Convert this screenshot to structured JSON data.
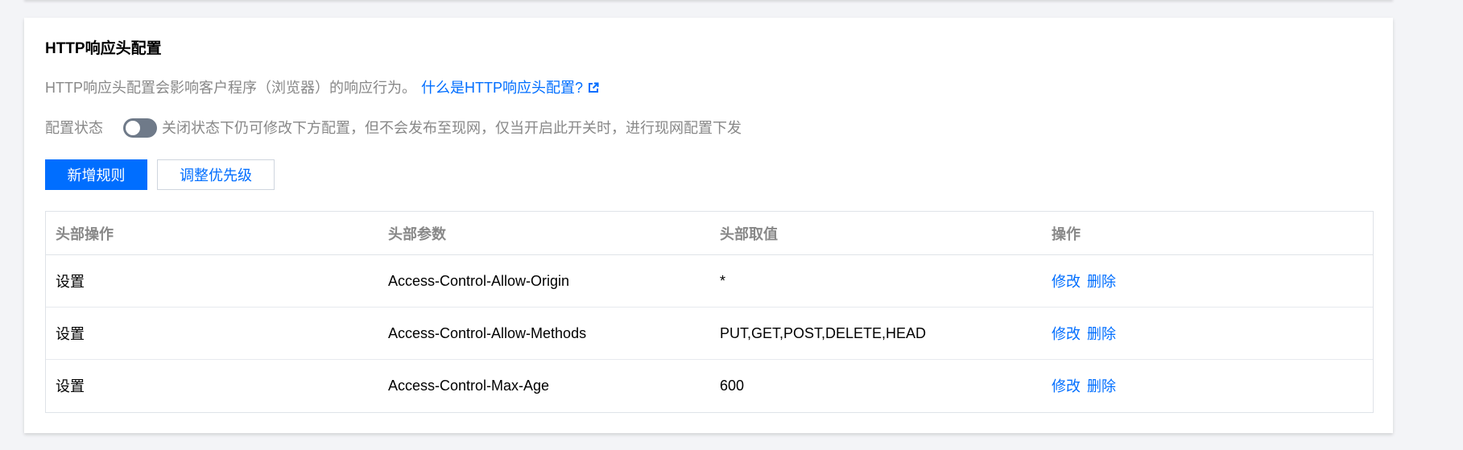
{
  "section": {
    "title": "HTTP响应头配置",
    "description": "HTTP响应头配置会影响客户程序（浏览器）的响应行为。",
    "help_link": "什么是HTTP响应头配置?",
    "help_link_icon": "external-link-icon"
  },
  "status": {
    "label": "配置状态",
    "toggle_on": false,
    "hint": "关闭状态下仍可修改下方配置，但不会发布至现网，仅当开启此开关时，进行现网配置下发"
  },
  "toolbar": {
    "add_rule_label": "新增规则",
    "adjust_priority_label": "调整优先级"
  },
  "table": {
    "columns": [
      "头部操作",
      "头部参数",
      "头部取值",
      "操作"
    ],
    "rows": [
      {
        "operation": "设置",
        "param": "Access-Control-Allow-Origin",
        "value": "*",
        "edit": "修改",
        "delete": "删除"
      },
      {
        "operation": "设置",
        "param": "Access-Control-Allow-Methods",
        "value": "PUT,GET,POST,DELETE,HEAD",
        "edit": "修改",
        "delete": "删除"
      },
      {
        "operation": "设置",
        "param": "Access-Control-Max-Age",
        "value": "600",
        "edit": "修改",
        "delete": "删除"
      }
    ]
  },
  "colors": {
    "primary": "#006eff",
    "toggle_off": "#6f7a89",
    "muted_text": "#888888",
    "border": "#dfe3e8",
    "background": "#f3f4f7"
  }
}
